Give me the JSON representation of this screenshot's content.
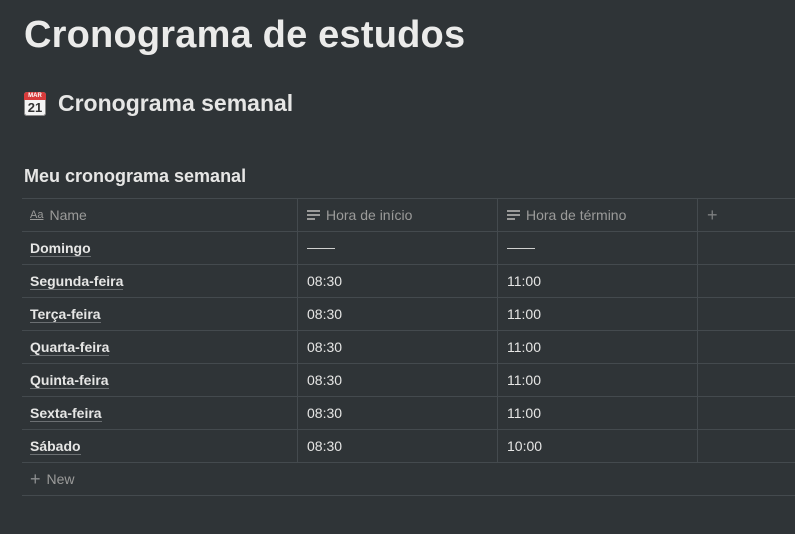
{
  "page": {
    "title": "Cronograma de estudos",
    "section_heading": "Cronograma semanal",
    "section_icon": {
      "name": "calendar-icon",
      "month": "MAR",
      "day": "21"
    }
  },
  "database": {
    "title": "Meu cronograma semanal",
    "columns": [
      {
        "label": "Name",
        "icon": "text-aa-icon"
      },
      {
        "label": "Hora de início",
        "icon": "text-lines-icon"
      },
      {
        "label": "Hora de término",
        "icon": "text-lines-icon"
      }
    ],
    "add_column_glyph": "+",
    "rows": [
      {
        "name": "Domingo",
        "start": "",
        "end": ""
      },
      {
        "name": "Segunda-feira",
        "start": "08:30",
        "end": "11:00"
      },
      {
        "name": "Terça-feira",
        "start": "08:30",
        "end": "11:00"
      },
      {
        "name": "Quarta-feira",
        "start": "08:30",
        "end": "11:00"
      },
      {
        "name": "Quinta-feira",
        "start": "08:30",
        "end": "11:00"
      },
      {
        "name": "Sexta-feira",
        "start": "08:30",
        "end": "11:00"
      },
      {
        "name": "Sábado",
        "start": "08:30",
        "end": "10:00"
      }
    ],
    "new_row_label": "New"
  },
  "colors": {
    "background": "#2f3437",
    "text": "#e6e6e5",
    "muted": "#9b9b9a",
    "border": "#444a4e"
  }
}
